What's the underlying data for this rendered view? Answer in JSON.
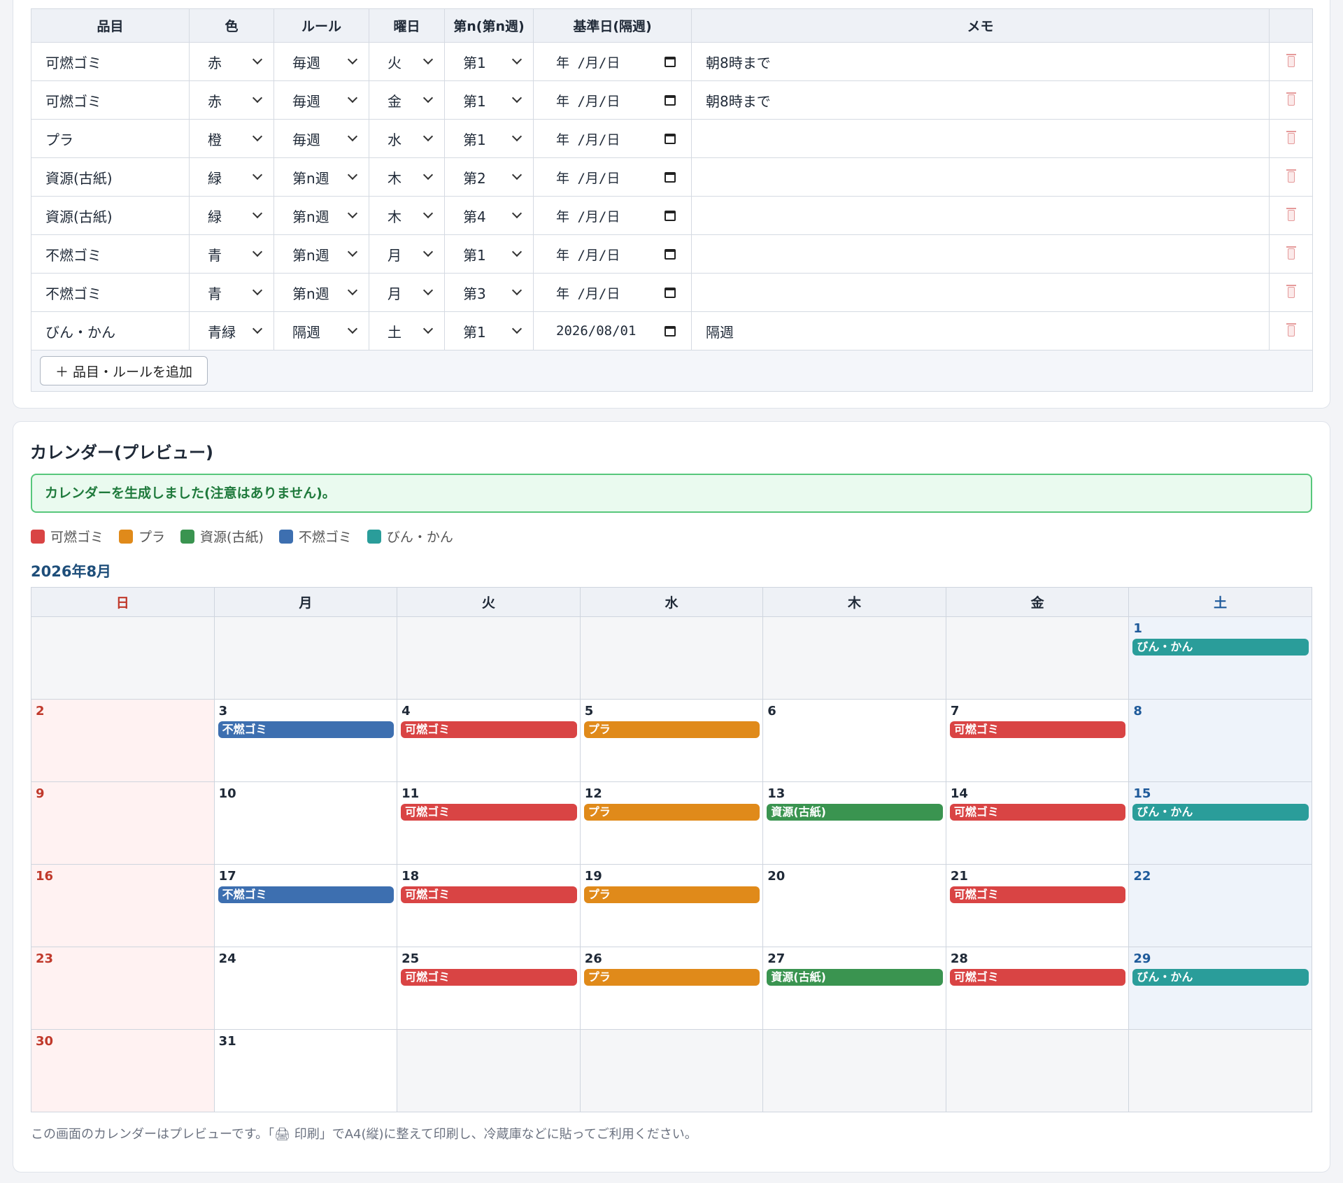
{
  "rules_table": {
    "headers": [
      "品目",
      "色",
      "ルール",
      "曜日",
      "第n(第n週)",
      "基準日(隔週)",
      "メモ",
      ""
    ],
    "date_placeholder": "年 /月/日",
    "rows": [
      {
        "name": "可燃ゴミ",
        "color": "赤",
        "rule": "毎週",
        "weekday": "火",
        "nth": "第1",
        "base_date": "",
        "memo": "朝8時まで"
      },
      {
        "name": "可燃ゴミ",
        "color": "赤",
        "rule": "毎週",
        "weekday": "金",
        "nth": "第1",
        "base_date": "",
        "memo": "朝8時まで"
      },
      {
        "name": "プラ",
        "color": "橙",
        "rule": "毎週",
        "weekday": "水",
        "nth": "第1",
        "base_date": "",
        "memo": ""
      },
      {
        "name": "資源(古紙)",
        "color": "緑",
        "rule": "第n週",
        "weekday": "木",
        "nth": "第2",
        "base_date": "",
        "memo": ""
      },
      {
        "name": "資源(古紙)",
        "color": "緑",
        "rule": "第n週",
        "weekday": "木",
        "nth": "第4",
        "base_date": "",
        "memo": ""
      },
      {
        "name": "不燃ゴミ",
        "color": "青",
        "rule": "第n週",
        "weekday": "月",
        "nth": "第1",
        "base_date": "",
        "memo": ""
      },
      {
        "name": "不燃ゴミ",
        "color": "青",
        "rule": "第n週",
        "weekday": "月",
        "nth": "第3",
        "base_date": "",
        "memo": ""
      },
      {
        "name": "びん・かん",
        "color": "青緑",
        "rule": "隔週",
        "weekday": "土",
        "nth": "第1",
        "base_date": "2026/08/01",
        "memo": "隔週"
      }
    ],
    "add_button_label": "＋ 品目・ルールを追加"
  },
  "calendar": {
    "title": "カレンダー(プレビュー)",
    "notice": "カレンダーを生成しました(注意はありません)。",
    "legend": [
      {
        "label": "可燃ゴミ",
        "color": "#d94444"
      },
      {
        "label": "プラ",
        "color": "#e08a1a"
      },
      {
        "label": "資源(古紙)",
        "color": "#3a9450"
      },
      {
        "label": "不燃ゴミ",
        "color": "#3d6fb0"
      },
      {
        "label": "びん・かん",
        "color": "#2a9d9a"
      }
    ],
    "month_label": "2026年8月",
    "weekdays": [
      "日",
      "月",
      "火",
      "水",
      "木",
      "金",
      "土"
    ],
    "weeks": [
      [
        null,
        null,
        null,
        null,
        null,
        null,
        {
          "day": "1",
          "events": [
            "びん・かん"
          ]
        }
      ],
      [
        {
          "day": "2",
          "events": []
        },
        {
          "day": "3",
          "events": [
            "不燃ゴミ"
          ]
        },
        {
          "day": "4",
          "events": [
            "可燃ゴミ"
          ]
        },
        {
          "day": "5",
          "events": [
            "プラ"
          ]
        },
        {
          "day": "6",
          "events": []
        },
        {
          "day": "7",
          "events": [
            "可燃ゴミ"
          ]
        },
        {
          "day": "8",
          "events": []
        }
      ],
      [
        {
          "day": "9",
          "events": []
        },
        {
          "day": "10",
          "events": []
        },
        {
          "day": "11",
          "events": [
            "可燃ゴミ"
          ]
        },
        {
          "day": "12",
          "events": [
            "プラ"
          ]
        },
        {
          "day": "13",
          "events": [
            "資源(古紙)"
          ]
        },
        {
          "day": "14",
          "events": [
            "可燃ゴミ"
          ]
        },
        {
          "day": "15",
          "events": [
            "びん・かん"
          ]
        }
      ],
      [
        {
          "day": "16",
          "events": []
        },
        {
          "day": "17",
          "events": [
            "不燃ゴミ"
          ]
        },
        {
          "day": "18",
          "events": [
            "可燃ゴミ"
          ]
        },
        {
          "day": "19",
          "events": [
            "プラ"
          ]
        },
        {
          "day": "20",
          "events": []
        },
        {
          "day": "21",
          "events": [
            "可燃ゴミ"
          ]
        },
        {
          "day": "22",
          "events": []
        }
      ],
      [
        {
          "day": "23",
          "events": []
        },
        {
          "day": "24",
          "events": []
        },
        {
          "day": "25",
          "events": [
            "可燃ゴミ"
          ]
        },
        {
          "day": "26",
          "events": [
            "プラ"
          ]
        },
        {
          "day": "27",
          "events": [
            "資源(古紙)"
          ]
        },
        {
          "day": "28",
          "events": [
            "可燃ゴミ"
          ]
        },
        {
          "day": "29",
          "events": [
            "びん・かん"
          ]
        }
      ],
      [
        {
          "day": "30",
          "events": []
        },
        {
          "day": "31",
          "events": []
        },
        null,
        null,
        null,
        null,
        null
      ]
    ],
    "footnote": "この画面のカレンダーはプレビューです。「🖨 印刷」でA4(縦)に整えて印刷し、冷蔵庫などに貼ってご利用ください。"
  }
}
